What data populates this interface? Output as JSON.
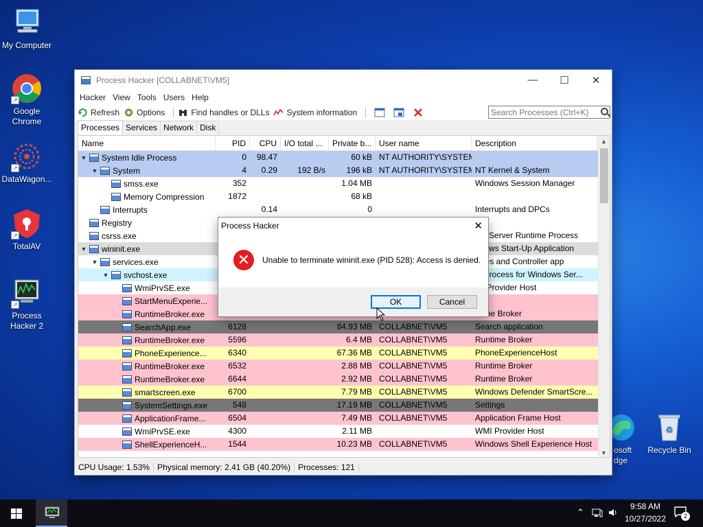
{
  "desktop": {
    "icons": [
      {
        "label": "My Computer"
      },
      {
        "label": "Google Chrome"
      },
      {
        "label": "DataWagon..."
      },
      {
        "label": "TotalAV"
      },
      {
        "label": "Process Hacker 2"
      },
      {
        "label": "osoft dge"
      },
      {
        "label": "Recycle Bin"
      }
    ]
  },
  "window": {
    "title": "Process Hacker [COLLABNET\\VM5]",
    "menu": [
      "Hacker",
      "View",
      "Tools",
      "Users",
      "Help"
    ],
    "toolbar": {
      "refresh": "Refresh",
      "options": "Options",
      "find_handles": "Find handles or DLLs",
      "system_info": "System information"
    },
    "search_placeholder": "Search Processes (Ctrl+K)",
    "tabs": [
      "Processes",
      "Services",
      "Network",
      "Disk"
    ],
    "columns": [
      "Name",
      "PID",
      "CPU",
      "I/O total ...",
      "Private b...",
      "User name",
      "Description"
    ],
    "rows": [
      {
        "name": "System Idle Process",
        "pid": "0",
        "cpu": "98.47",
        "io": "",
        "priv": "60 kB",
        "user": "NT AUTHORITY\\SYSTEM",
        "desc": ""
      },
      {
        "name": "System",
        "pid": "4",
        "cpu": "0.29",
        "io": "192 B/s",
        "priv": "196 kB",
        "user": "NT AUTHORITY\\SYSTEM",
        "desc": "NT Kernel & System"
      },
      {
        "name": "smss.exe",
        "pid": "352",
        "cpu": "",
        "io": "",
        "priv": "1.04 MB",
        "user": "",
        "desc": "Windows Session Manager"
      },
      {
        "name": "Memory Compression",
        "pid": "1872",
        "cpu": "",
        "io": "",
        "priv": "68 kB",
        "user": "",
        "desc": ""
      },
      {
        "name": "Interrupts",
        "pid": "",
        "cpu": "0.14",
        "io": "",
        "priv": "0",
        "user": "",
        "desc": "Interrupts and DPCs"
      },
      {
        "name": "Registry",
        "pid": "",
        "cpu": "",
        "io": "",
        "priv": "",
        "user": "",
        "desc": ""
      },
      {
        "name": "csrss.exe",
        "pid": "",
        "cpu": "",
        "io": "",
        "priv": "",
        "user": "",
        "desc": "ent Server Runtime Process"
      },
      {
        "name": "wininit.exe",
        "pid": "",
        "cpu": "",
        "io": "",
        "priv": "",
        "user": "",
        "desc": "ndows Start-Up Application"
      },
      {
        "name": "services.exe",
        "pid": "",
        "cpu": "",
        "io": "",
        "priv": "",
        "user": "",
        "desc": "vices and Controller app"
      },
      {
        "name": "svchost.exe",
        "pid": "",
        "cpu": "",
        "io": "",
        "priv": "",
        "user": "",
        "desc": "st Process for Windows Ser..."
      },
      {
        "name": "WmiPrvSE.exe",
        "pid": "",
        "cpu": "",
        "io": "",
        "priv": "",
        "user": "",
        "desc": "MI Provider Host"
      },
      {
        "name": "StartMenuExperie...",
        "pid": "",
        "cpu": "",
        "io": "",
        "priv": "",
        "user": "",
        "desc": ""
      },
      {
        "name": "RuntimeBroker.exe",
        "pid": "",
        "cpu": "",
        "io": "",
        "priv": "",
        "user": "",
        "desc": "ntime Broker"
      },
      {
        "name": "SearchApp.exe",
        "pid": "6128",
        "cpu": "",
        "io": "",
        "priv": "84.93 MB",
        "user": "COLLABNET\\VM5",
        "desc": "Search application"
      },
      {
        "name": "RuntimeBroker.exe",
        "pid": "5596",
        "cpu": "",
        "io": "",
        "priv": "6.4 MB",
        "user": "COLLABNET\\VM5",
        "desc": "Runtime Broker"
      },
      {
        "name": "PhoneExperience...",
        "pid": "6340",
        "cpu": "",
        "io": "",
        "priv": "67.36 MB",
        "user": "COLLABNET\\VM5",
        "desc": "PhoneExperienceHost"
      },
      {
        "name": "RuntimeBroker.exe",
        "pid": "6532",
        "cpu": "",
        "io": "",
        "priv": "2.88 MB",
        "user": "COLLABNET\\VM5",
        "desc": "Runtime Broker"
      },
      {
        "name": "RuntimeBroker.exe",
        "pid": "6644",
        "cpu": "",
        "io": "",
        "priv": "2.92 MB",
        "user": "COLLABNET\\VM5",
        "desc": "Runtime Broker"
      },
      {
        "name": "smartscreen.exe",
        "pid": "6700",
        "cpu": "",
        "io": "",
        "priv": "7.79 MB",
        "user": "COLLABNET\\VM5",
        "desc": "Windows Defender SmartScre..."
      },
      {
        "name": "SystemSettings.exe",
        "pid": "548",
        "cpu": "",
        "io": "",
        "priv": "17.19 MB",
        "user": "COLLABNET\\VM5",
        "desc": "Settings"
      },
      {
        "name": "ApplicationFrame...",
        "pid": "6504",
        "cpu": "",
        "io": "",
        "priv": "7.49 MB",
        "user": "COLLABNET\\VM5",
        "desc": "Application Frame Host"
      },
      {
        "name": "WmiPrvSE.exe",
        "pid": "4300",
        "cpu": "",
        "io": "",
        "priv": "2.11 MB",
        "user": "",
        "desc": "WMI Provider Host"
      },
      {
        "name": "ShellExperienceH...",
        "pid": "1544",
        "cpu": "",
        "io": "",
        "priv": "10.23 MB",
        "user": "COLLABNET\\VM5",
        "desc": "Windows Shell Experience Host"
      }
    ],
    "status": {
      "cpu": "CPU Usage: 1.53%",
      "memory": "Physical memory: 2.41 GB (40.20%)",
      "processes": "Processes: 121"
    }
  },
  "dialog": {
    "title": "Process Hacker",
    "message": "Unable to terminate wininit.exe (PID 528): Access is denied.",
    "ok": "OK",
    "cancel": "Cancel"
  },
  "taskbar": {
    "time": "9:58 AM",
    "date": "10/27/2022",
    "notification_count": "2"
  }
}
